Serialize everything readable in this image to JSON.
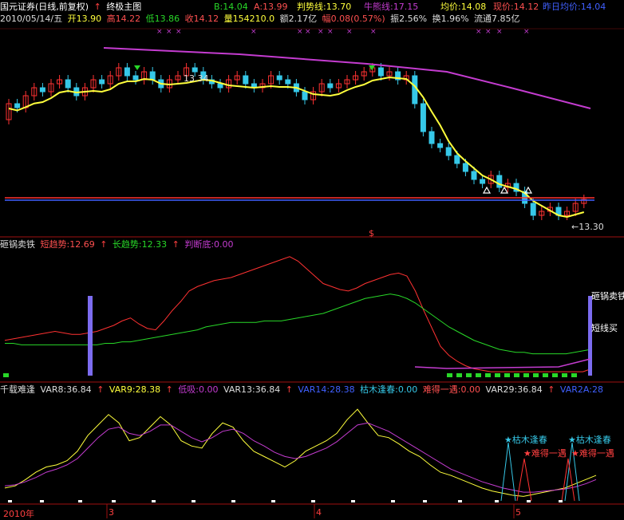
{
  "header": {
    "title": "国元证券(日线,前复权)",
    "indicator": "终极主图",
    "B": "B:14.04",
    "A": "A:13.99",
    "trend": "判势线:13.70",
    "bull": "牛熊线:17.15",
    "avg": "均价:14.08",
    "price": "现价:14.12",
    "prev_avg": "昨日均价:14.04",
    "date": "2010/05/14/五",
    "open": "开13.90",
    "high": "高14.22",
    "low": "低13.86",
    "close": "收14.12",
    "vol": "量154210.0",
    "amount": "额2.17亿",
    "change": "幅0.08(0.57%)",
    "amp": "振2.56%",
    "turnover": "换1.96%",
    "float": "流通7.85亿"
  },
  "panel2": {
    "name": "砸锅卖铁",
    "short": "短趋势:12.69",
    "long": "长趋势:12.33",
    "bottom": "判断底:0.00",
    "tag1": "砸锅卖铁",
    "tag2": "短线买"
  },
  "panel3": {
    "name": "千载难逢",
    "v8": "VAR8:36.84",
    "v9": "VAR9:28.38",
    "absorb": "低吸:0.00",
    "v13": "VAR13:36.84",
    "v14": "VAR14:28.38",
    "dry": "枯木逢春:0.00",
    "rare": "难得一遇:0.00",
    "v29": "VAR29:36.84",
    "v2a": "VAR2A:28",
    "tag_dry": "★枯木逢春",
    "tag_rare": "★难得一遇",
    "tag_mix": "★枯木逢春"
  },
  "price_labels": {
    "high_mark": "13.34",
    "low_mark": "←13.30",
    "dollar": "$"
  },
  "axis": {
    "year": "2010年",
    "m3": "3",
    "m4": "4",
    "m5": "5"
  },
  "colors": {
    "up": "#ff3232",
    "down": "#36c8e8",
    "yellow": "#ffff3c",
    "purple": "#c43cd0",
    "green": "#28d828",
    "blue": "#4060ff"
  },
  "chart_data": {
    "type": "line",
    "candles": [
      {
        "o": 12.2,
        "c": 12.6
      },
      {
        "o": 12.6,
        "c": 12.5
      },
      {
        "o": 12.5,
        "c": 12.8
      },
      {
        "o": 12.8,
        "c": 13.0
      },
      {
        "o": 13.0,
        "c": 12.9
      },
      {
        "o": 12.9,
        "c": 13.1
      },
      {
        "o": 13.1,
        "c": 13.2
      },
      {
        "o": 13.2,
        "c": 13.0
      },
      {
        "o": 13.0,
        "c": 12.8
      },
      {
        "o": 12.8,
        "c": 13.0
      },
      {
        "o": 13.0,
        "c": 13.2
      },
      {
        "o": 13.2,
        "c": 13.1
      },
      {
        "o": 13.1,
        "c": 13.3
      },
      {
        "o": 13.3,
        "c": 13.5
      },
      {
        "o": 13.5,
        "c": 13.3
      },
      {
        "o": 13.3,
        "c": 13.2
      },
      {
        "o": 13.2,
        "c": 13.4
      },
      {
        "o": 13.4,
        "c": 13.2
      },
      {
        "o": 13.2,
        "c": 13.0
      },
      {
        "o": 13.0,
        "c": 13.2
      },
      {
        "o": 13.2,
        "c": 13.3
      },
      {
        "o": 13.3,
        "c": 13.5
      },
      {
        "o": 13.5,
        "c": 13.4
      },
      {
        "o": 13.4,
        "c": 13.2
      },
      {
        "o": 13.2,
        "c": 13.1
      },
      {
        "o": 13.1,
        "c": 13.0
      },
      {
        "o": 13.0,
        "c": 13.2
      },
      {
        "o": 13.2,
        "c": 13.3
      },
      {
        "o": 13.3,
        "c": 13.1
      },
      {
        "o": 13.1,
        "c": 13.0
      },
      {
        "o": 13.0,
        "c": 13.1
      },
      {
        "o": 13.1,
        "c": 13.3
      },
      {
        "o": 13.3,
        "c": 13.2
      },
      {
        "o": 13.2,
        "c": 13.1
      },
      {
        "o": 13.1,
        "c": 12.9
      },
      {
        "o": 12.9,
        "c": 12.7
      },
      {
        "o": 12.7,
        "c": 12.9
      },
      {
        "o": 12.9,
        "c": 13.1
      },
      {
        "o": 13.1,
        "c": 13.0
      },
      {
        "o": 13.0,
        "c": 13.1
      },
      {
        "o": 13.1,
        "c": 13.2
      },
      {
        "o": 13.2,
        "c": 13.3
      },
      {
        "o": 13.3,
        "c": 13.4
      },
      {
        "o": 13.4,
        "c": 13.5
      },
      {
        "o": 13.5,
        "c": 13.3
      },
      {
        "o": 13.3,
        "c": 13.4
      },
      {
        "o": 13.4,
        "c": 13.2
      },
      {
        "o": 13.2,
        "c": 13.3
      },
      {
        "o": 13.3,
        "c": 12.6
      },
      {
        "o": 12.6,
        "c": 11.9
      },
      {
        "o": 11.9,
        "c": 11.6
      },
      {
        "o": 11.6,
        "c": 11.5
      },
      {
        "o": 11.5,
        "c": 11.3
      },
      {
        "o": 11.3,
        "c": 11.1
      },
      {
        "o": 11.1,
        "c": 10.9
      },
      {
        "o": 10.9,
        "c": 10.7
      },
      {
        "o": 10.7,
        "c": 10.6
      },
      {
        "o": 10.6,
        "c": 10.8
      },
      {
        "o": 10.8,
        "c": 10.5
      },
      {
        "o": 10.5,
        "c": 10.6
      },
      {
        "o": 10.6,
        "c": 10.4
      },
      {
        "o": 10.4,
        "c": 10.1
      },
      {
        "o": 10.1,
        "c": 9.8
      },
      {
        "o": 9.8,
        "c": 9.9
      },
      {
        "o": 9.9,
        "c": 10.0
      },
      {
        "o": 10.0,
        "c": 9.8
      },
      {
        "o": 9.8,
        "c": 9.9
      },
      {
        "o": 9.9,
        "c": 10.1
      },
      {
        "o": 10.1,
        "c": 10.2
      }
    ],
    "short_trend": [
      22,
      23,
      24,
      25,
      26,
      27,
      28,
      27,
      26,
      26,
      27,
      28,
      30,
      32,
      35,
      37,
      33,
      30,
      29,
      35,
      42,
      48,
      55,
      58,
      60,
      62,
      63,
      64,
      66,
      68,
      70,
      72,
      74,
      76,
      78,
      75,
      70,
      65,
      60,
      58,
      56,
      55,
      57,
      60,
      62,
      64,
      66,
      67,
      65,
      55,
      42,
      30,
      18,
      12,
      8,
      5,
      3,
      2,
      1,
      1,
      1,
      1,
      1,
      1,
      1,
      1,
      1,
      1,
      1,
      1,
      3
    ],
    "long_trend": [
      20,
      20,
      19,
      19,
      19,
      19,
      19,
      19,
      19,
      19,
      19,
      19,
      20,
      20,
      21,
      21,
      22,
      23,
      24,
      25,
      26,
      27,
      28,
      29,
      31,
      32,
      33,
      34,
      34,
      34,
      34,
      35,
      35,
      35,
      36,
      37,
      38,
      39,
      40,
      42,
      44,
      46,
      48,
      50,
      51,
      52,
      53,
      52,
      50,
      47,
      43,
      39,
      35,
      31,
      28,
      25,
      22,
      20,
      18,
      16,
      15,
      14,
      14,
      13,
      13,
      13,
      13,
      13,
      14,
      15,
      16
    ],
    "var8": [
      10,
      12,
      18,
      25,
      30,
      32,
      36,
      45,
      60,
      70,
      80,
      72,
      55,
      58,
      68,
      78,
      70,
      55,
      50,
      48,
      62,
      72,
      68,
      55,
      45,
      40,
      35,
      30,
      36,
      45,
      50,
      55,
      62,
      75,
      85,
      72,
      60,
      58,
      52,
      45,
      40,
      32,
      25,
      22,
      18,
      14,
      10,
      7,
      5,
      3,
      2,
      4,
      6,
      8,
      10,
      14,
      18,
      22
    ],
    "var9": [
      12,
      13,
      16,
      20,
      25,
      28,
      32,
      38,
      48,
      58,
      66,
      68,
      62,
      60,
      64,
      70,
      70,
      64,
      58,
      54,
      58,
      64,
      66,
      62,
      55,
      50,
      44,
      40,
      38,
      40,
      44,
      48,
      54,
      62,
      70,
      72,
      68,
      64,
      58,
      52,
      46,
      40,
      34,
      28,
      24,
      20,
      16,
      13,
      10,
      8,
      6,
      6,
      7,
      8,
      9,
      11,
      14,
      18
    ]
  }
}
